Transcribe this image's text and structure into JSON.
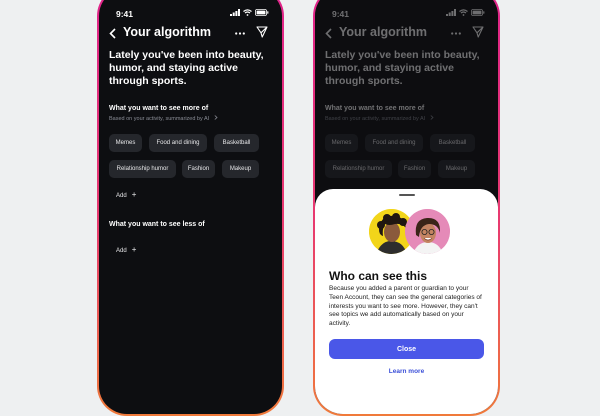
{
  "status_time": "9:41",
  "header": {
    "title": "Your algorithm"
  },
  "headline": "Lately you've been into beauty, humor, and staying active through sports.",
  "more_section": {
    "title": "What you want to see more of",
    "subtitle": "Based on your activity, summarized by AI",
    "chips": [
      "Memes",
      "Food and dining",
      "Basketball",
      "Relationship humor",
      "Fashion",
      "Makeup"
    ],
    "add_label": "Add"
  },
  "less_section": {
    "title": "What you want to see less of",
    "add_label": "Add"
  },
  "sheet": {
    "title": "Who can see this",
    "body": "Because you added a parent or guardian to your Teen Account, they can see the general categories of interests you want to see more. However, they can't see topics we add automatically based on your activity.",
    "close_label": "Close",
    "learn_more_label": "Learn more"
  },
  "colors": {
    "accent": "#4a57e8",
    "link": "#3b4fd8",
    "frame_top": "#e0238b",
    "frame_bottom": "#f07a3a",
    "screen_bg": "#0d0e11",
    "chip_bg": "#25272c"
  },
  "icons": [
    "back-chevron-icon",
    "more-dots-icon",
    "send-icon",
    "signal-icon",
    "wifi-icon",
    "battery-icon",
    "chevron-right-icon",
    "plus-icon"
  ]
}
